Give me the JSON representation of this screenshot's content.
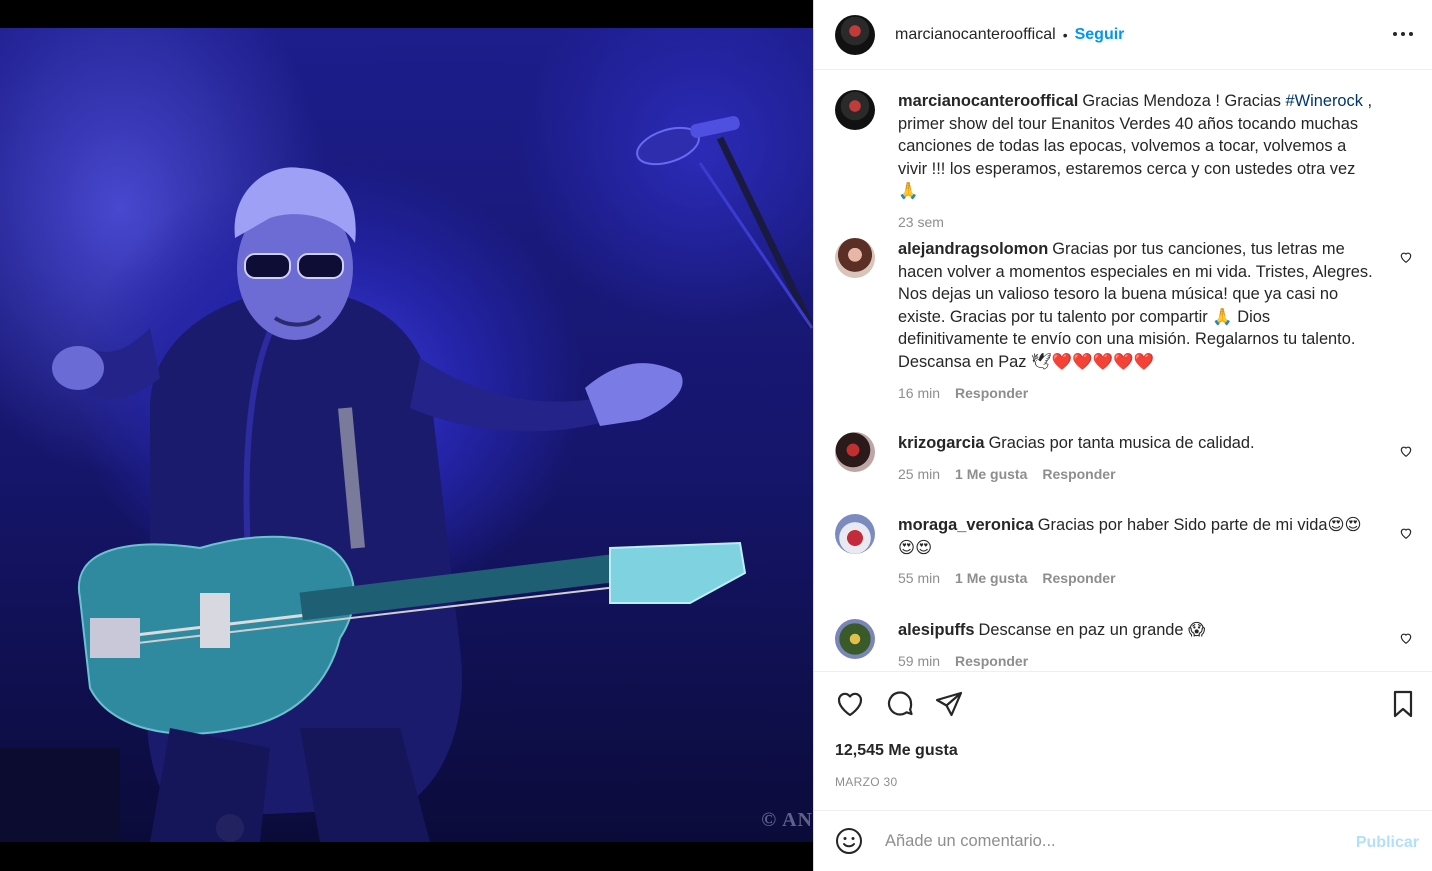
{
  "post": {
    "author": "marcianocanterooffical",
    "follow_label": "Seguir",
    "separator": "•",
    "watermark": "© AN"
  },
  "caption": {
    "username": "marcianocanterooffical",
    "text_before": "Gracias Mendoza ! Gracias ",
    "hashtag": "#Winerock",
    "text_after": " , primer show del tour Enanitos Verdes 40 años tocando muchas canciones de todas las epocas, volvemos a tocar, volvemos a vivir !!! los esperamos, estaremos cerca y con ustedes otra vez 🙏",
    "time": "23 sem"
  },
  "comments": [
    {
      "username": "alejandragsolomon",
      "text": "Gracias por tus canciones, tus letras me hacen volver a momentos especiales en mi vida. Tristes, Alegres. Nos dejas un valioso tesoro la buena música! que ya casi no existe. Gracias por tu talento por compartir 🙏 Dios definitivamente te envío con una misión. Regalarnos tu talento. Descansa en Paz 🕊❤️❤️❤️❤️❤️",
      "time": "16 min",
      "likes": "",
      "reply": "Responder"
    },
    {
      "username": "krizogarcia",
      "text": "Gracias por tanta musica de calidad.",
      "time": "25 min",
      "likes": "1 Me gusta",
      "reply": "Responder"
    },
    {
      "username": "moraga_veronica",
      "text": "Gracias por haber Sido parte de mi vida😍😍😍😍",
      "time": "55 min",
      "likes": "1 Me gusta",
      "reply": "Responder"
    },
    {
      "username": "alesipuffs",
      "text": "Descanse en paz un grande 😱",
      "time": "59 min",
      "likes": "",
      "reply": "Responder"
    }
  ],
  "stats": {
    "likes": "12,545 Me gusta",
    "date": "MARZO 30"
  },
  "composer": {
    "placeholder": "Añade un comentario...",
    "publish_label": "Publicar"
  },
  "icons": {
    "more": "more-options-icon",
    "like": "heart-icon",
    "comment": "comment-bubble-icon",
    "share": "paper-plane-icon",
    "save": "bookmark-icon",
    "emoji": "smiley-icon"
  }
}
